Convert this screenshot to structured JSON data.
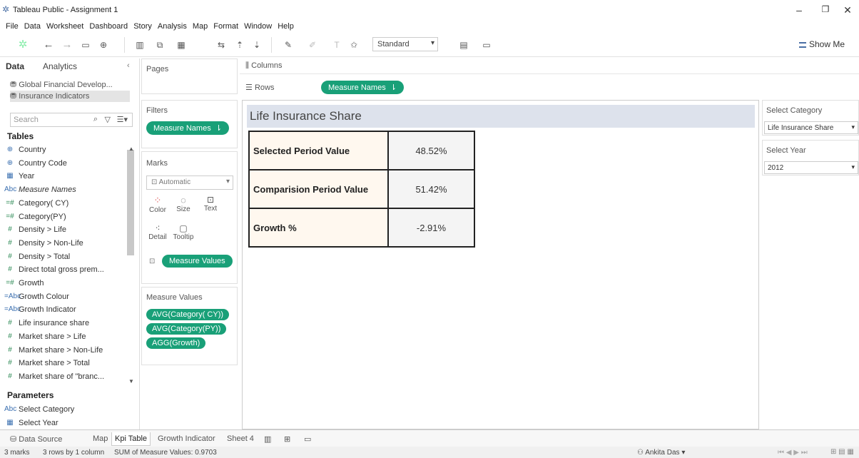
{
  "window": {
    "title": "Tableau Public - Assignment 1"
  },
  "menu": [
    "File",
    "Data",
    "Worksheet",
    "Dashboard",
    "Story",
    "Analysis",
    "Map",
    "Format",
    "Window",
    "Help"
  ],
  "toolbar": {
    "fit": "Standard",
    "show_me": "Show Me"
  },
  "left_pane": {
    "tab_data": "Data",
    "tab_analytics": "Analytics",
    "sources": [
      "Global Financial Develop...",
      "Insurance Indicators"
    ],
    "search_placeholder": "Search",
    "tables_header": "Tables",
    "fields": [
      {
        "icon": "globe",
        "name": "Country"
      },
      {
        "icon": "globe",
        "name": "Country Code"
      },
      {
        "icon": "calendar",
        "name": "Year"
      },
      {
        "icon": "Abc",
        "name": "Measure Names"
      },
      {
        "icon": "=#",
        "name": "Category( CY)"
      },
      {
        "icon": "=#",
        "name": "Category(PY)"
      },
      {
        "icon": "#",
        "name": "Density > Life"
      },
      {
        "icon": "#",
        "name": "Density > Non-Life"
      },
      {
        "icon": "#",
        "name": "Density > Total"
      },
      {
        "icon": "#",
        "name": "Direct total gross prem..."
      },
      {
        "icon": "=#",
        "name": "Growth"
      },
      {
        "icon": "=Abc",
        "name": "Growth Colour"
      },
      {
        "icon": "=Abc",
        "name": "Growth Indicator"
      },
      {
        "icon": "#",
        "name": "Life insurance share"
      },
      {
        "icon": "#",
        "name": "Market share > Life"
      },
      {
        "icon": "#",
        "name": "Market share > Non-Life"
      },
      {
        "icon": "#",
        "name": "Market share > Total"
      },
      {
        "icon": "#",
        "name": "Market share of \"branc..."
      }
    ],
    "parameters_header": "Parameters",
    "parameters": [
      {
        "icon": "Abc",
        "name": "Select Category"
      },
      {
        "icon": "calendar",
        "name": "Select Year"
      }
    ]
  },
  "shelves": {
    "pages": "Pages",
    "columns": "Columns",
    "rows": "Rows",
    "rows_pill": "Measure Names",
    "filters": "Filters",
    "filters_pill": "Measure Names",
    "marks": "Marks",
    "marks_type": "Automatic",
    "mark_cards": [
      "Color",
      "Size",
      "Text",
      "Detail",
      "Tooltip"
    ],
    "marks_pill": "Measure Values",
    "measure_values": "Measure Values",
    "measure_values_pills": [
      "AVG(Category( CY))",
      "AVG(Category(PY))",
      "AGG(Growth)"
    ]
  },
  "viz": {
    "title": "Life Insurance Share",
    "rows": [
      {
        "label": "Selected Period Value",
        "value": "48.52%"
      },
      {
        "label": "Comparision Period Value",
        "value": "51.42%"
      },
      {
        "label": "Growth  %",
        "value": "-2.91%"
      }
    ]
  },
  "right_pane": {
    "category_label": "Select Category",
    "category_value": "Life Insurance Share",
    "year_label": "Select Year",
    "year_value": "2012"
  },
  "bottom_tabs": [
    "Data Source",
    "Map",
    "Kpi Table",
    "Growth Indicator",
    "Sheet 4"
  ],
  "status": {
    "marks": "3 marks",
    "rows": "3 rows by 1 column",
    "sum": "SUM of Measure Values: 0.9703",
    "user": "Ankita Das"
  },
  "colors": {
    "pill": "#19a078",
    "title_bg": "#dde2ec",
    "label_bg": "#fff8ef"
  }
}
